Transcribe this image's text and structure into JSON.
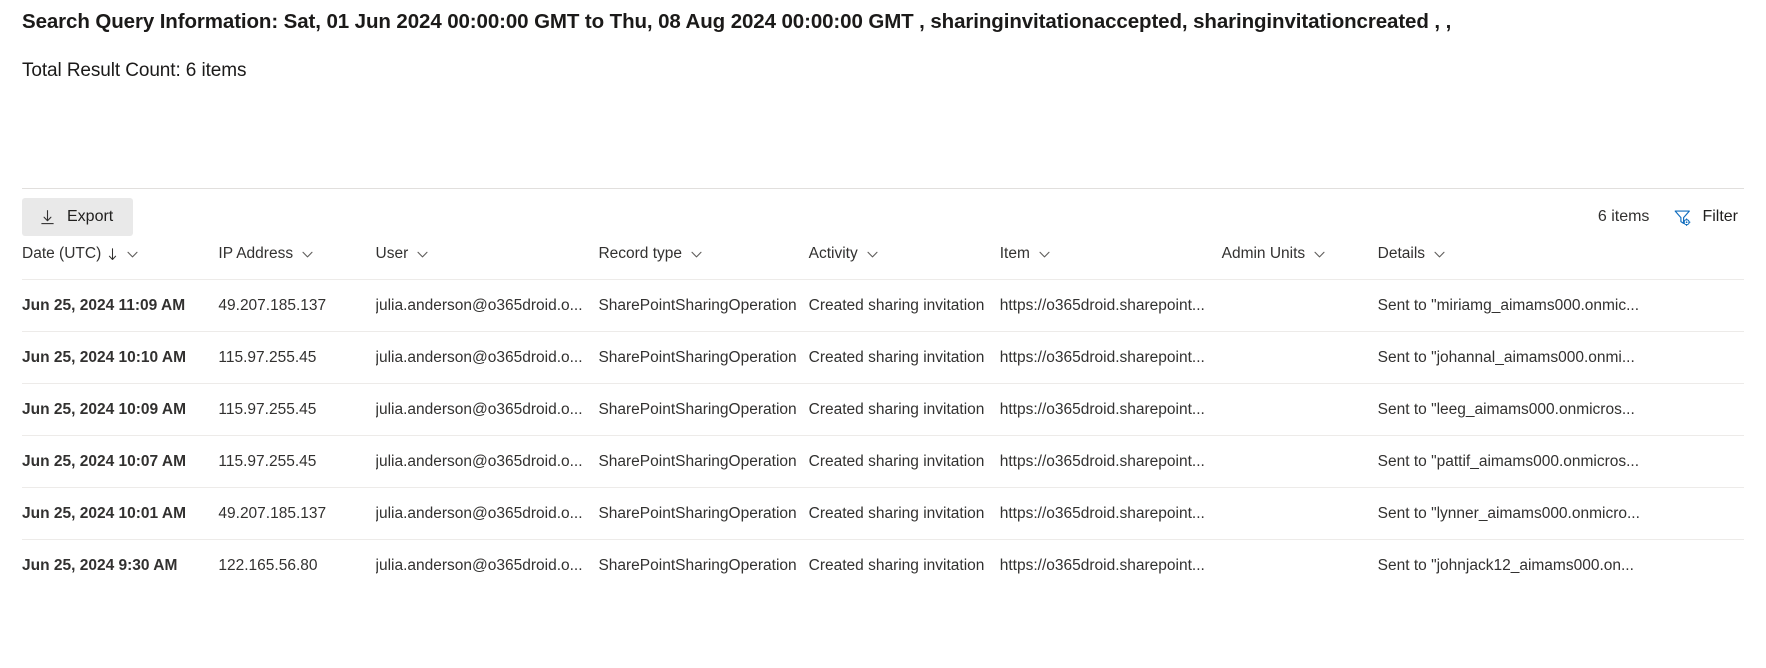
{
  "header": {
    "query_title": "Search Query Information: Sat, 01 Jun 2024 00:00:00 GMT to Thu, 08 Aug 2024 00:00:00 GMT , sharinginvitationaccepted, sharinginvitationcreated , ,",
    "result_count": "Total Result Count: 6 items"
  },
  "toolbar": {
    "export_label": "Export",
    "export_icon": "download-icon",
    "items_count": "6 items",
    "filter_label": "Filter",
    "filter_icon": "funnel-gear-icon",
    "accent_color": "#0f6cbd"
  },
  "table": {
    "columns": [
      {
        "label": "Date (UTC)",
        "sorted": true,
        "sort_direction": "desc",
        "has_chevron": true
      },
      {
        "label": "IP Address",
        "sorted": false,
        "has_chevron": true
      },
      {
        "label": "User",
        "sorted": false,
        "has_chevron": true
      },
      {
        "label": "Record type",
        "sorted": false,
        "has_chevron": true
      },
      {
        "label": "Activity",
        "sorted": false,
        "has_chevron": true
      },
      {
        "label": "Item",
        "sorted": false,
        "has_chevron": true
      },
      {
        "label": "Admin Units",
        "sorted": false,
        "has_chevron": true
      },
      {
        "label": "Details",
        "sorted": false,
        "has_chevron": true
      }
    ],
    "rows": [
      {
        "date": "Jun 25, 2024 11:09 AM",
        "ip": "49.207.185.137",
        "user": "julia.anderson@o365droid.o...",
        "record_type": "SharePointSharingOperation",
        "activity": "Created sharing invitation",
        "item": "https://o365droid.sharepoint...",
        "admin_units": "",
        "details": "Sent to \"miriamg_aimams000.onmic..."
      },
      {
        "date": "Jun 25, 2024 10:10 AM",
        "ip": "115.97.255.45",
        "user": "julia.anderson@o365droid.o...",
        "record_type": "SharePointSharingOperation",
        "activity": "Created sharing invitation",
        "item": "https://o365droid.sharepoint...",
        "admin_units": "",
        "details": "Sent to \"johannal_aimams000.onmi..."
      },
      {
        "date": "Jun 25, 2024 10:09 AM",
        "ip": "115.97.255.45",
        "user": "julia.anderson@o365droid.o...",
        "record_type": "SharePointSharingOperation",
        "activity": "Created sharing invitation",
        "item": "https://o365droid.sharepoint...",
        "admin_units": "",
        "details": "Sent to \"leeg_aimams000.onmicros..."
      },
      {
        "date": "Jun 25, 2024 10:07 AM",
        "ip": "115.97.255.45",
        "user": "julia.anderson@o365droid.o...",
        "record_type": "SharePointSharingOperation",
        "activity": "Created sharing invitation",
        "item": "https://o365droid.sharepoint...",
        "admin_units": "",
        "details": "Sent to \"pattif_aimams000.onmicros..."
      },
      {
        "date": "Jun 25, 2024 10:01 AM",
        "ip": "49.207.185.137",
        "user": "julia.anderson@o365droid.o...",
        "record_type": "SharePointSharingOperation",
        "activity": "Created sharing invitation",
        "item": "https://o365droid.sharepoint...",
        "admin_units": "",
        "details": "Sent to \"lynner_aimams000.onmicro..."
      },
      {
        "date": "Jun 25, 2024 9:30 AM",
        "ip": "122.165.56.80",
        "user": "julia.anderson@o365droid.o...",
        "record_type": "SharePointSharingOperation",
        "activity": "Created sharing invitation",
        "item": "https://o365droid.sharepoint...",
        "admin_units": "",
        "details": "Sent to \"johnjack12_aimams000.on..."
      }
    ]
  }
}
